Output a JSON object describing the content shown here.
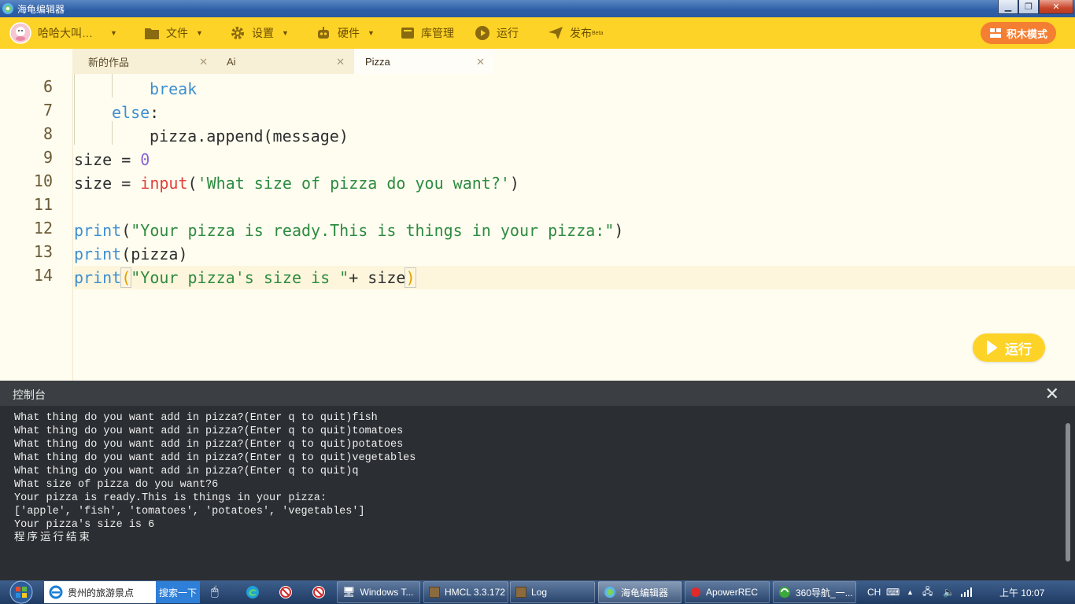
{
  "window": {
    "title": "海龟编辑器",
    "minimize_label": "▁",
    "maximize_label": "❐",
    "close_label": "✕"
  },
  "toolbar": {
    "user_name": "哈哈大叫…",
    "menus": [
      {
        "label": "文件",
        "icon": "folder-icon",
        "has_caret": true
      },
      {
        "label": "设置",
        "icon": "gear-icon",
        "has_caret": true
      },
      {
        "label": "硬件",
        "icon": "robot-icon",
        "has_caret": true
      },
      {
        "label": "库管理",
        "icon": "library-icon",
        "has_caret": false
      },
      {
        "label": "运行",
        "icon": "play-circle-icon",
        "has_caret": false
      },
      {
        "label": "发布",
        "icon": "paper-plane-icon",
        "has_caret": false,
        "badge": "Beta"
      }
    ],
    "mode_button": "积木模式"
  },
  "tabs": [
    {
      "label": "新的作品",
      "active": false
    },
    {
      "label": "Ai",
      "active": false
    },
    {
      "label": "Pizza",
      "active": true
    }
  ],
  "tab_close": "✕",
  "editor": {
    "line_numbers": [
      "6",
      "7",
      "8",
      "9",
      "10",
      "11",
      "12",
      "13",
      "14"
    ],
    "code": {
      "l6_kw": "break",
      "l7_kw": "else",
      "l7_colon": ":",
      "l8_text": "pizza.append(message)",
      "l9_var": "size = ",
      "l9_num": "0",
      "l10_var": "size = ",
      "l10_fn": "input",
      "l10_open": "(",
      "l10_str": "'What size of pizza do you want?'",
      "l10_close": ")",
      "l12_fn": "print",
      "l12_open": "(",
      "l12_str": "\"Your pizza is ready.This is things in your pizza:\"",
      "l12_close": ")",
      "l13_fn": "print",
      "l13_rest": "(pizza)",
      "l14_fn": "print",
      "l14_open": "(",
      "l14_str": "\"Your pizza's size is \"",
      "l14_rest": "+ size",
      "l14_close": ")"
    },
    "run_button": "运行"
  },
  "console": {
    "title": "控制台",
    "close": "✕",
    "lines": [
      "What thing do you want add in pizza?(Enter q to quit)fish",
      "What thing do you want add in pizza?(Enter q to quit)tomatoes",
      "What thing do you want add in pizza?(Enter q to quit)potatoes",
      "What thing do you want add in pizza?(Enter q to quit)vegetables",
      "What thing do you want add in pizza?(Enter q to quit)q",
      "What size of pizza do you want?6",
      "Your pizza is ready.This is things in your pizza:",
      "['apple', 'fish', 'tomatoes', 'potatoes', 'vegetables']",
      "Your pizza's size is 6",
      "程序运行结束"
    ]
  },
  "taskbar": {
    "search_text": "贵州的旅游景点",
    "search_button": "搜索一下",
    "tasks": [
      {
        "label": "Windows T...",
        "icon": "monitor-icon"
      },
      {
        "label": "HMCL 3.3.172",
        "icon": "minecraft-block-icon"
      },
      {
        "label": "Log",
        "icon": "minecraft-block-icon"
      },
      {
        "label": "海龟编辑器",
        "icon": "turtle-app-icon",
        "active": true
      },
      {
        "label": "ApowerREC",
        "icon": "record-icon"
      },
      {
        "label": "360导航_一...",
        "icon": "browser-360-icon"
      }
    ],
    "tray_lang": "CH",
    "clock": "上午 10:07"
  },
  "colors": {
    "toolbar_bg": "#fed327",
    "mode_button_bg": "#f47e31",
    "editor_bg": "#fffdf0",
    "console_bg": "#2b2e32",
    "keyword": "#3d8fd1",
    "string": "#2e8b40",
    "builtin": "#e0413b",
    "number": "#8a64d6"
  }
}
